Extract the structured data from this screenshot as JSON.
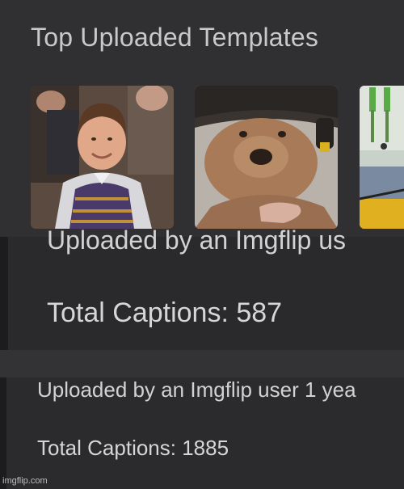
{
  "section": {
    "title": "Top Uploaded Templates"
  },
  "templates": [
    {
      "uploaded_by": "Uploaded by an Imgflip us",
      "total_captions": "Total Captions: 587"
    },
    {
      "uploaded_by": "Uploaded by an Imgflip user 1 yea",
      "total_captions": "Total Captions: 1885"
    }
  ],
  "watermark": "imgflip.com",
  "colors": {
    "background": "#2c2c2e",
    "text": "#d4d4d4"
  }
}
